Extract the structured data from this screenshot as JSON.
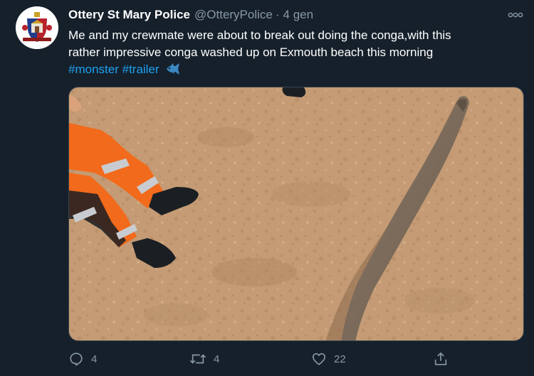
{
  "tweet": {
    "display_name": "Ottery St Mary Police",
    "handle": "@OtteryPolice",
    "separator": "·",
    "time": "4 gen",
    "text_line1": "Me and  my crewmate were about to break out doing the conga,with this",
    "text_line2": "rather impressive conga washed up on Exmouth beach this morning",
    "hashtags": [
      "#monster",
      "#trailer"
    ],
    "emoji": "fish-icon"
  },
  "actions": {
    "reply_count": "4",
    "retweet_count": "4",
    "like_count": "22",
    "share_count": ""
  },
  "colors": {
    "background": "#15202b",
    "secondary_text": "#8899a6",
    "hashtag": "#1da1f2",
    "sand": "#c49b74",
    "hi_vis_orange": "#f26a1b",
    "eel": "#7d6c5c"
  }
}
